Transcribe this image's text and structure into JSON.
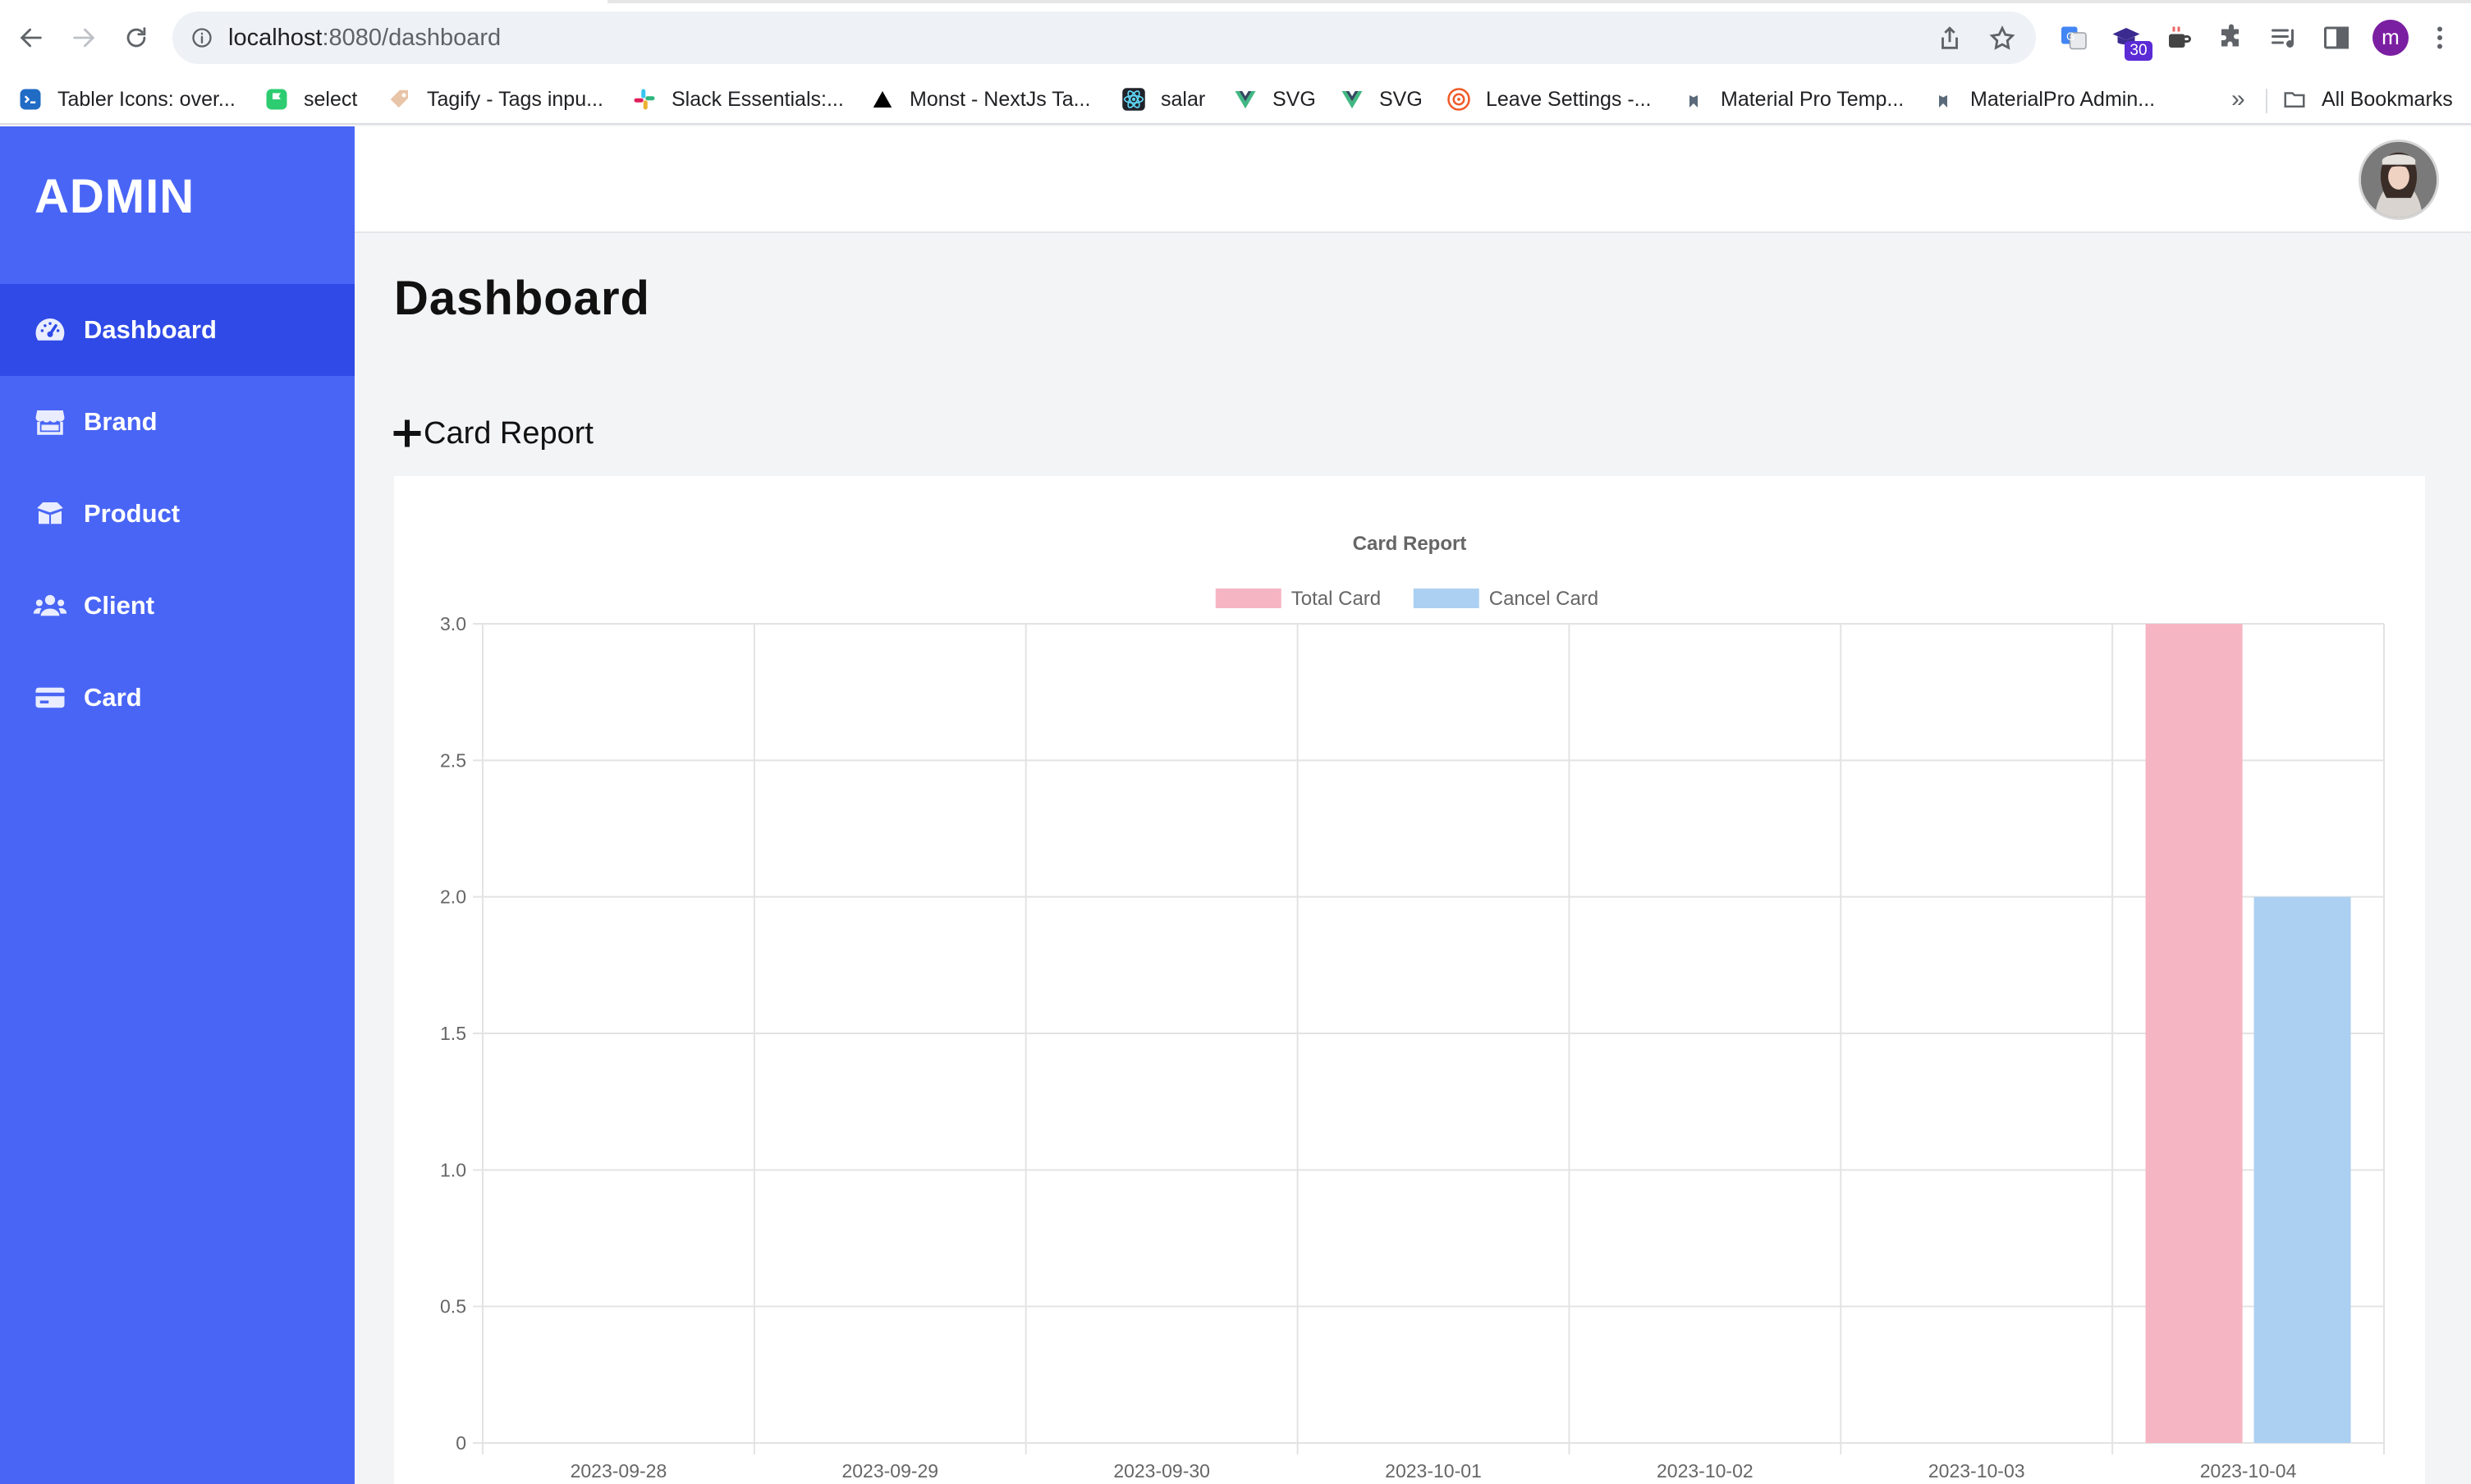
{
  "browser": {
    "url_host": "localhost",
    "url_rest": ":8080/dashboard",
    "bookmarks": [
      {
        "label": "Tabler Icons: over...",
        "icon": "tabler-icon"
      },
      {
        "label": "select",
        "icon": "flag-icon"
      },
      {
        "label": "Tagify - Tags inpu...",
        "icon": "tag-icon"
      },
      {
        "label": "Slack Essentials:...",
        "icon": "slack-icon"
      },
      {
        "label": "Monst - NextJs Ta...",
        "icon": "triangle-icon"
      },
      {
        "label": "salar",
        "icon": "react-icon"
      },
      {
        "label": "SVG",
        "icon": "vue-icon"
      },
      {
        "label": "SVG",
        "icon": "vue-icon"
      },
      {
        "label": "Leave Settings -...",
        "icon": "target-icon"
      },
      {
        "label": "Material Pro Temp...",
        "icon": "materialpro-icon"
      },
      {
        "label": "MaterialPro Admin...",
        "icon": "materialpro-icon"
      }
    ],
    "all_bookmarks": "All Bookmarks",
    "more": "»",
    "extension_badge": "30",
    "profile_initial": "m"
  },
  "sidebar": {
    "brand": "ADMIN",
    "items": [
      {
        "label": "Dashboard",
        "icon": "gauge-icon",
        "active": true
      },
      {
        "label": "Brand",
        "icon": "store-icon",
        "active": false
      },
      {
        "label": "Product",
        "icon": "box-icon",
        "active": false
      },
      {
        "label": "Client",
        "icon": "users-icon",
        "active": false
      },
      {
        "label": "Card",
        "icon": "credit-card-icon",
        "active": false
      }
    ]
  },
  "page": {
    "title": "Dashboard",
    "section_title": "Card Report"
  },
  "colors": {
    "sidebar": "#4965f5",
    "sidebar_active": "#2f4ae6",
    "total_card": "#f6b5c3",
    "cancel_card": "#acd0f2"
  },
  "chart_data": {
    "type": "bar",
    "title": "Card Report",
    "categories": [
      "2023-09-28",
      "2023-09-29",
      "2023-09-30",
      "2023-10-01",
      "2023-10-02",
      "2023-10-03",
      "2023-10-04"
    ],
    "series": [
      {
        "name": "Total Card",
        "values": [
          0,
          0,
          0,
          0,
          0,
          0,
          3
        ],
        "color": "#f6b5c3"
      },
      {
        "name": "Cancel Card",
        "values": [
          0,
          0,
          0,
          0,
          0,
          0,
          2
        ],
        "color": "#acd0f2"
      }
    ],
    "yticks": [
      "0",
      "0.5",
      "1.0",
      "1.5",
      "2.0",
      "2.5",
      "3.0"
    ],
    "ylim": [
      0,
      3
    ],
    "legend": "top-center",
    "grid": true
  }
}
